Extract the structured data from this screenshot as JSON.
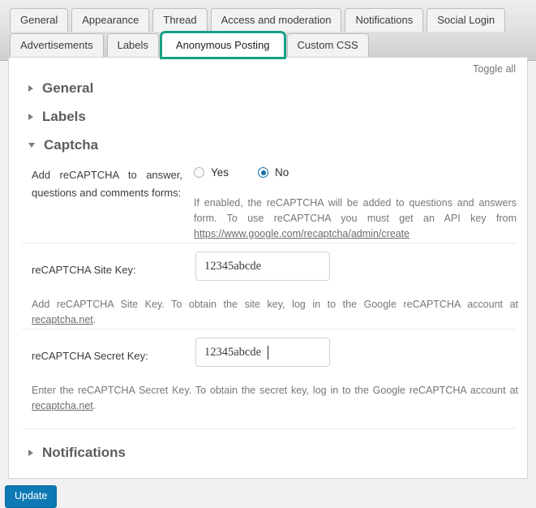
{
  "tabs": {
    "row1": [
      {
        "label": "General",
        "active": false
      },
      {
        "label": "Appearance",
        "active": false
      },
      {
        "label": "Thread",
        "active": false
      },
      {
        "label": "Access and moderation",
        "active": false
      },
      {
        "label": "Notifications",
        "active": false
      },
      {
        "label": "Social Login",
        "active": false
      }
    ],
    "row2": [
      {
        "label": "Advertisements",
        "active": false
      },
      {
        "label": "Labels",
        "active": false
      },
      {
        "label": "Anonymous Posting",
        "active": true
      },
      {
        "label": "Custom CSS",
        "active": false
      }
    ],
    "active_tab": "Anonymous Posting",
    "active_highlight_color": "#16a085"
  },
  "panel": {
    "toggle_all_label": "Toggle all",
    "sections": [
      {
        "title": "General",
        "expanded": false,
        "marker": "chevron-right-icon"
      },
      {
        "title": "Labels",
        "expanded": false,
        "marker": "chevron-right-icon"
      },
      {
        "title": "Captcha",
        "expanded": true,
        "marker": "chevron-down-icon"
      },
      {
        "title": "Notifications",
        "expanded": false,
        "marker": "chevron-right-icon"
      }
    ]
  },
  "captcha": {
    "enable": {
      "label": "Add reCAPTCHA to answer, questions and comments forms:",
      "options": [
        {
          "label": "Yes",
          "value": "yes",
          "selected": false
        },
        {
          "label": "No",
          "value": "no",
          "selected": true
        }
      ],
      "selected_value": "no",
      "hint_text": "If enabled, the reCAPTCHA will be added to questions and answers form. To use reCAPTCHA you must get an API key from ",
      "hint_link": "https://www.google.com/recaptcha/admin/create"
    },
    "site_key": {
      "label": "reCAPTCHA Site Key:",
      "value": "12345abcde",
      "placeholder": "",
      "hint_before": "Add reCAPTCHA Site Key. To obtain the site key, log in to the Google reCAPTCHA account at ",
      "hint_link": "recaptcha.net",
      "hint_after": "."
    },
    "secret_key": {
      "label": "reCAPTCHA Secret Key:",
      "value": "12345abcde",
      "placeholder": "",
      "focused": true,
      "hint_before": "Enter the reCAPTCHA Secret Key. To obtain the secret key, log in to the Google reCAPTCHA account at ",
      "hint_link": "recaptcha.net",
      "hint_after": "."
    }
  },
  "footer": {
    "update_label": "Update",
    "update_color": "#0e7ab5"
  }
}
